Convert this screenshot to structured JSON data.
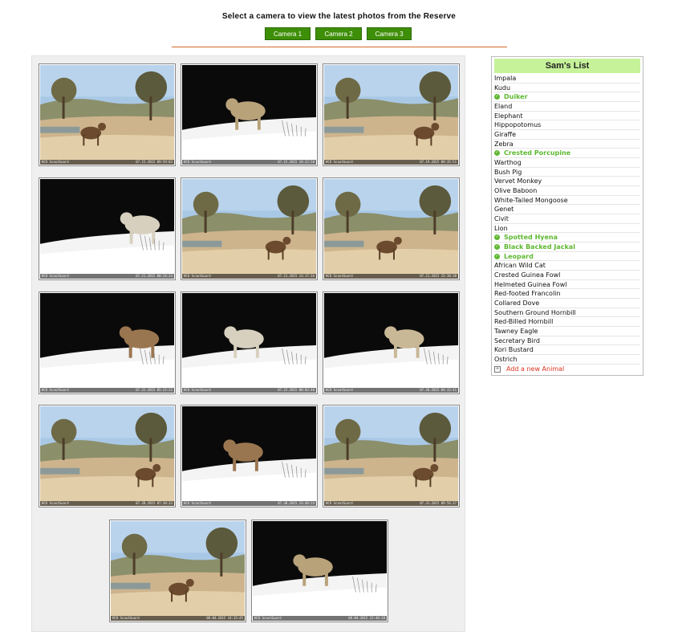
{
  "heading": "Select a camera to view the latest photos from the Reserve",
  "cameras": [
    "Camera 1",
    "Camera 2",
    "Camera 3"
  ],
  "colors": {
    "accent": "#3e8f08",
    "seen": "#5fb832",
    "list_header": "#c6f29a",
    "add_link": "#d9331f",
    "divider": "#d46a2a"
  },
  "photos": [
    {
      "subject": "Helmeted Guinea Fowl",
      "scene": "day",
      "brand": "HCO ScoutGuard",
      "timestamp": "07.15.2015 09:59:03"
    },
    {
      "subject": "Spotted Hyena",
      "scene": "night",
      "brand": "HCO ScoutGuard",
      "timestamp": "07.15.2015 19:22:58"
    },
    {
      "subject": "Duiker",
      "scene": "day",
      "brand": "HCO ScoutGuard",
      "timestamp": "07.19.2015 09:35:51"
    },
    {
      "subject": "Warthog",
      "scene": "night",
      "brand": "HCO ScoutGuard",
      "timestamp": "07.21.2015 00:24:24"
    },
    {
      "subject": "Landscape",
      "scene": "day",
      "brand": "HCO ScoutGuard",
      "timestamp": "07.21.2015 13:17:16"
    },
    {
      "subject": "Elephant",
      "scene": "day",
      "brand": "HCO ScoutGuard",
      "timestamp": "07.21.2015 15:30:30"
    },
    {
      "subject": "Black Backed Jackal",
      "scene": "night",
      "brand": "HCO ScoutGuard",
      "timestamp": "07.22.2015 05:22:21"
    },
    {
      "subject": "Spotted Hyena",
      "scene": "night",
      "brand": "HCO ScoutGuard",
      "timestamp": "07.22.2015 00:02:40"
    },
    {
      "subject": "Crested Porcupine",
      "scene": "night",
      "brand": "HCO ScoutGuard",
      "timestamp": "07.26.2015 04:32:41"
    },
    {
      "subject": "Red-footed Francolin",
      "scene": "day",
      "brand": "HCO ScoutGuard",
      "timestamp": "07.28.2015 07:30:33"
    },
    {
      "subject": "Civit",
      "scene": "night",
      "brand": "HCO ScoutGuard",
      "timestamp": "07.30.2015 23:40:24"
    },
    {
      "subject": "Kudu",
      "scene": "day",
      "brand": "HCO ScoutGuard",
      "timestamp": "07.31.2015 09:56:37"
    },
    {
      "subject": "Vervet Monkey",
      "scene": "day",
      "brand": "HCO ScoutGuard",
      "timestamp": "08.04.2015 14:15:45"
    },
    {
      "subject": "Leopard",
      "scene": "night",
      "brand": "HCO ScoutGuard",
      "timestamp": "08.04.2015 22:40:28"
    }
  ],
  "list": {
    "title": "Sam's List",
    "animals": [
      {
        "name": "Impala",
        "seen": false
      },
      {
        "name": "Kudu",
        "seen": false
      },
      {
        "name": "Duiker",
        "seen": true
      },
      {
        "name": "Eland",
        "seen": false
      },
      {
        "name": "Elephant",
        "seen": false
      },
      {
        "name": "Hippopotomus",
        "seen": false
      },
      {
        "name": "Giraffe",
        "seen": false
      },
      {
        "name": "Zebra",
        "seen": false
      },
      {
        "name": "Crested Porcupine",
        "seen": true
      },
      {
        "name": "Warthog",
        "seen": false
      },
      {
        "name": "Bush Pig",
        "seen": false
      },
      {
        "name": "Vervet Monkey",
        "seen": false
      },
      {
        "name": "Olive Baboon",
        "seen": false
      },
      {
        "name": "White-Tailed Mongoose",
        "seen": false
      },
      {
        "name": "Genet",
        "seen": false
      },
      {
        "name": "Civit",
        "seen": false
      },
      {
        "name": "Lion",
        "seen": false
      },
      {
        "name": "Spotted Hyena",
        "seen": true
      },
      {
        "name": "Black Backed Jackal",
        "seen": true
      },
      {
        "name": "Leopard",
        "seen": true
      },
      {
        "name": "African Wild Cat",
        "seen": false
      },
      {
        "name": "Crested Guinea Fowl",
        "seen": false
      },
      {
        "name": "Helmeted Guinea Fowl",
        "seen": false
      },
      {
        "name": "Red-footed Francolin",
        "seen": false
      },
      {
        "name": "Collared Dove",
        "seen": false
      },
      {
        "name": "Southern Ground Hornbill",
        "seen": false
      },
      {
        "name": "Red-Billed Hornbill",
        "seen": false
      },
      {
        "name": "Tawney Eagle",
        "seen": false
      },
      {
        "name": "Secretary Bird",
        "seen": false
      },
      {
        "name": "Kori Bustard",
        "seen": false
      },
      {
        "name": "Ostrich",
        "seen": false
      }
    ],
    "add_label": "Add a new Animal",
    "add_icon": "plus-box-icon",
    "check_icon": "check-circle-icon"
  }
}
